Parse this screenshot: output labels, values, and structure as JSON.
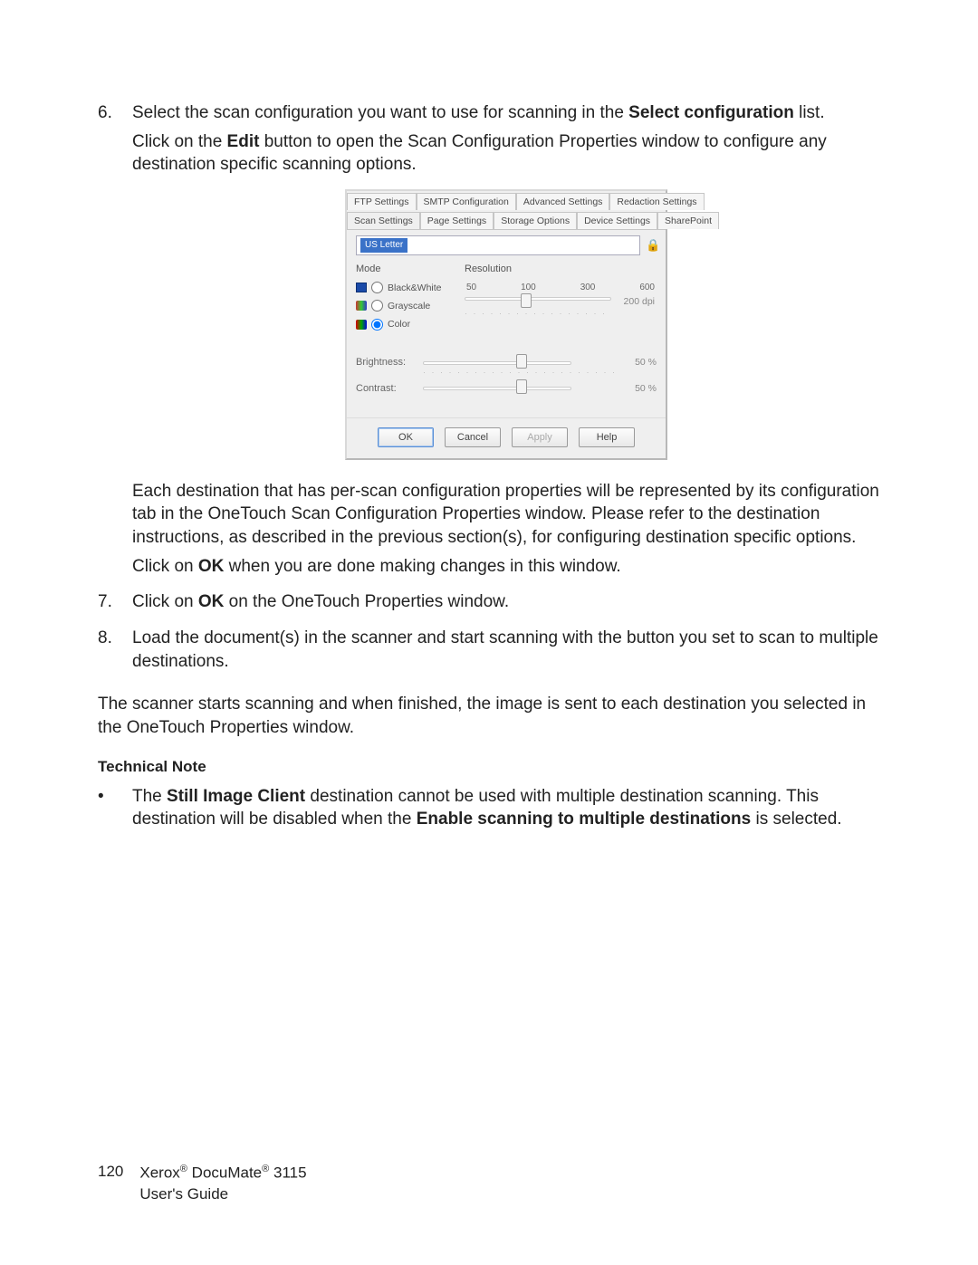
{
  "steps": {
    "s6": {
      "num": "6.",
      "p1a": "Select the scan configuration you want to use for scanning in the ",
      "p1b": "Select configuration",
      "p1c": " list.",
      "p2a": "Click on the ",
      "p2b": "Edit",
      "p2c": " button to open the Scan Configuration Properties window to configure any destination specific scanning options."
    },
    "s6_after": {
      "p1": "Each destination that has per-scan configuration properties will be represented by its configuration tab in the OneTouch Scan Configuration Properties window. Please refer to the destination instructions, as described in the previous section(s), for configuring destination specific options.",
      "p2a": "Click on ",
      "p2b": "OK",
      "p2c": " when you are done making changes in this window."
    },
    "s7": {
      "num": "7.",
      "p1a": "Click on ",
      "p1b": "OK",
      "p1c": " on the OneTouch Properties window."
    },
    "s8": {
      "num": "8.",
      "p1": "Load the document(s) in the scanner and start scanning with the button you set to scan to multiple destinations."
    }
  },
  "after": "The scanner starts scanning and when finished, the image is sent to each destination you selected in the OneTouch Properties window.",
  "tech_head": "Technical Note",
  "tech_bullet": {
    "a": "The ",
    "b": "Still Image Client",
    "c": " destination cannot be used with multiple destination scanning. This destination will be disabled when the ",
    "d": "Enable scanning to multiple destinations",
    "e": " is selected."
  },
  "dialog": {
    "tabs_row1": [
      "FTP Settings",
      "SMTP Configuration",
      "Advanced Settings",
      "Redaction Settings"
    ],
    "tabs_row2": [
      "Scan Settings",
      "Page Settings",
      "Storage Options",
      "Device Settings",
      "SharePoint"
    ],
    "config_name": "US Letter",
    "mode_label": "Mode",
    "mode_bw": "Black&White",
    "mode_gs": "Grayscale",
    "mode_cl": "Color",
    "res_label": "Resolution",
    "res_ticks": [
      "50",
      "100",
      "300",
      "600"
    ],
    "res_value": "200 dpi",
    "brightness_label": "Brightness:",
    "brightness_value": "50 %",
    "contrast_label": "Contrast:",
    "contrast_value": "50 %",
    "buttons": {
      "ok": "OK",
      "cancel": "Cancel",
      "apply": "Apply",
      "help": "Help"
    }
  },
  "footer": {
    "page": "120",
    "line1a": "Xerox",
    "line1b": " DocuMate",
    "line1c": " 3115",
    "reg": "®",
    "line2": "User's Guide"
  }
}
